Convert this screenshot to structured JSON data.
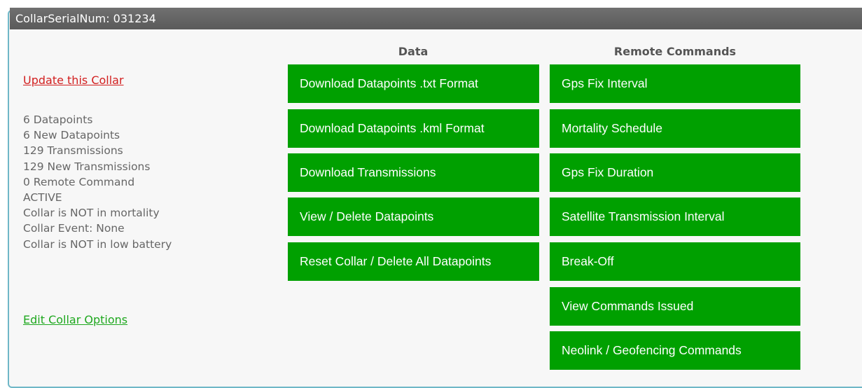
{
  "header": {
    "title": "CollarSerialNum: 031234"
  },
  "left": {
    "update_link": "Update this Collar",
    "stats": [
      "6 Datapoints",
      "6 New Datapoints",
      "129 Transmissions",
      "129 New Transmissions",
      "0 Remote Command",
      "ACTIVE",
      "Collar is NOT in mortality",
      "Collar Event: None",
      "Collar is NOT in low battery"
    ],
    "edit_link": "Edit Collar Options"
  },
  "data_column": {
    "heading": "Data",
    "buttons": [
      "Download Datapoints .txt Format",
      "Download Datapoints .kml Format",
      "Download Transmissions",
      "View / Delete Datapoints",
      "Reset Collar / Delete All Datapoints"
    ]
  },
  "remote_column": {
    "heading": "Remote Commands",
    "buttons": [
      "Gps Fix Interval",
      "Mortality Schedule",
      "Gps Fix Duration",
      "Satellite Transmission Interval",
      "Break-Off",
      "View Commands Issued",
      "Neolink / Geofencing Commands"
    ]
  },
  "colors": {
    "button_green": "#00a000",
    "update_link": "#d21f1f",
    "edit_link": "#1fa81f",
    "title_bar": "#5f5f5f",
    "panel_border": "#6fb7c7"
  }
}
